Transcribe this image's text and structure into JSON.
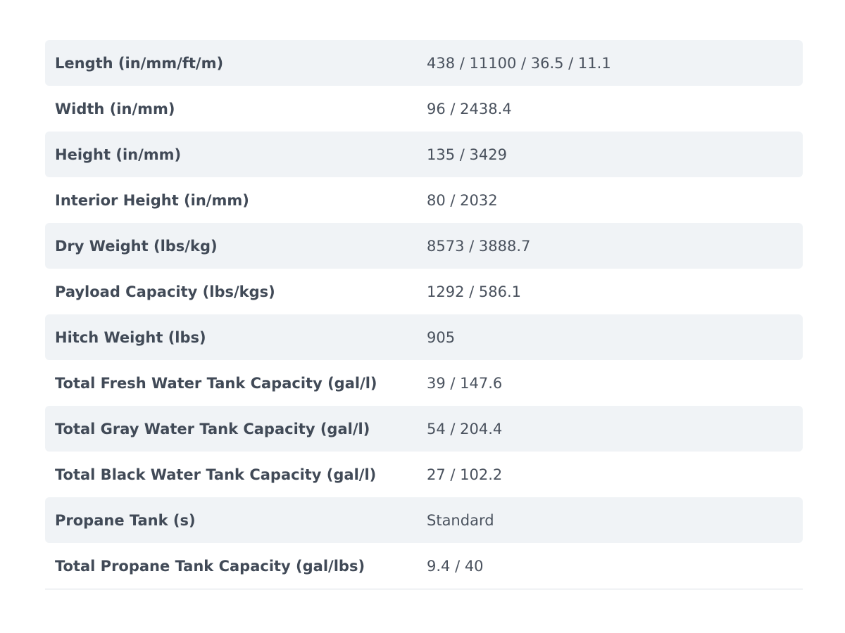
{
  "specs": [
    {
      "label": "Length (in/mm/ft/m)",
      "value": "438 / 11100 / 36.5 / 11.1"
    },
    {
      "label": "Width (in/mm)",
      "value": "96 / 2438.4"
    },
    {
      "label": "Height (in/mm)",
      "value": "135 / 3429"
    },
    {
      "label": "Interior Height (in/mm)",
      "value": "80 / 2032"
    },
    {
      "label": "Dry Weight (lbs/kg)",
      "value": "8573 / 3888.7"
    },
    {
      "label": "Payload Capacity (lbs/kgs)",
      "value": "1292 / 586.1"
    },
    {
      "label": "Hitch Weight (lbs)",
      "value": "905"
    },
    {
      "label": "Total Fresh Water Tank Capacity (gal/l)",
      "value": "39 / 147.6"
    },
    {
      "label": "Total Gray Water Tank Capacity (gal/l)",
      "value": "54 / 204.4"
    },
    {
      "label": "Total Black Water Tank Capacity (gal/l)",
      "value": "27 / 102.2"
    },
    {
      "label": "Propane Tank (s)",
      "value": "Standard"
    },
    {
      "label": "Total Propane Tank Capacity (gal/lbs)",
      "value": "9.4 / 40"
    }
  ],
  "colors": {
    "stripe": "#f0f3f6",
    "label_text": "#414a57",
    "value_text": "#4a525e",
    "divider": "#d8dde3"
  }
}
